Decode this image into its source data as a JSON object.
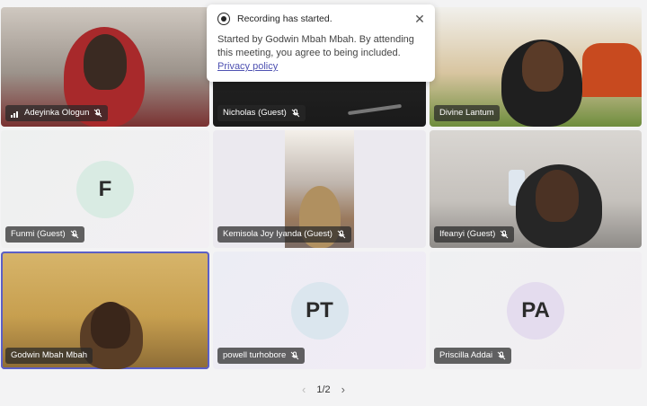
{
  "toast": {
    "title": "Recording has started.",
    "body": "Started by Godwin Mbah Mbah. By attending this meeting, you agree to being included.",
    "link": "Privacy policy"
  },
  "participants": [
    {
      "name": "Adeyinka Ologun",
      "muted": true,
      "video": true
    },
    {
      "name": "Nicholas (Guest)",
      "muted": true,
      "video": true
    },
    {
      "name": "Divine Lantum",
      "muted": false,
      "video": true
    },
    {
      "name": "Funmi (Guest)",
      "muted": true,
      "initials": "F"
    },
    {
      "name": "Kemisola Joy Iyanda (Guest)",
      "muted": true,
      "video": true
    },
    {
      "name": "Ifeanyi (Guest)",
      "muted": true,
      "video": true
    },
    {
      "name": "Godwin Mbah Mbah",
      "muted": false,
      "video": true
    },
    {
      "name": "powell turhobore",
      "muted": true,
      "initials": "PT"
    },
    {
      "name": "Priscilla Addai",
      "muted": true,
      "initials": "PA"
    }
  ],
  "pager": {
    "label": "1/2"
  },
  "colors": {
    "avatar_f": "#d9ebe3",
    "avatar_pt": "#dbe6ee",
    "avatar_pa": "#e4dcee",
    "speaking_border": "#5b5fc7"
  }
}
